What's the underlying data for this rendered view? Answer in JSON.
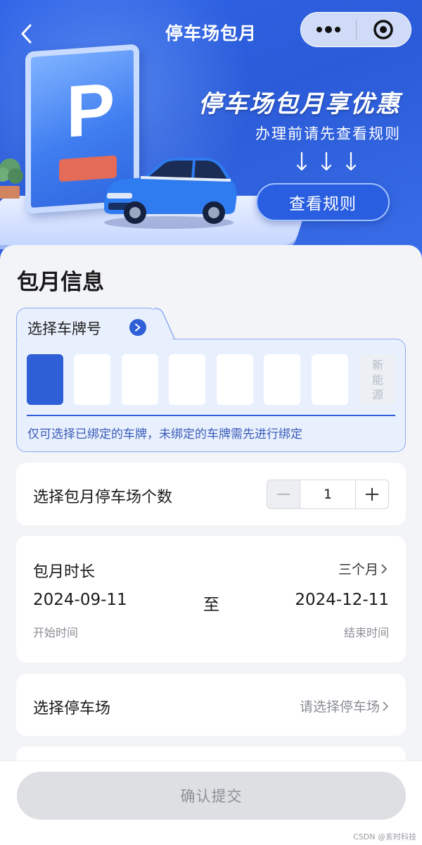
{
  "nav": {
    "title": "停车场包月",
    "back_icon": "chevron-left-icon",
    "more_icon": "more-dots-icon",
    "close_icon": "target-close-icon"
  },
  "banner": {
    "headline": "停车场包月享优惠",
    "subline": "办理前请先查看规则",
    "rules_button": "查看规则",
    "sign_letter": "P"
  },
  "info": {
    "section_title": "包月信息",
    "plate": {
      "label": "选择车牌号",
      "new_energy": [
        "新",
        "能",
        "源"
      ],
      "hint": "仅可选择已绑定的车牌，未绑定的车牌需先进行绑定"
    },
    "count": {
      "label": "选择包月停车场个数",
      "value": "1"
    },
    "duration": {
      "label": "包月时长",
      "value": "三个月",
      "start_date": "2024-09-11",
      "to": "至",
      "end_date": "2024-12-11",
      "start_label": "开始时间",
      "end_label": "结束时间"
    },
    "lot": {
      "label": "选择停车场",
      "placeholder": "请选择停车场"
    }
  },
  "footer": {
    "submit": "确认提交",
    "watermark": "CSDN @亥时科技"
  },
  "colors": {
    "primary": "#2f5fd6",
    "banner": "#2b5bd8",
    "plate_bg": "#e9f0fd",
    "disabled_button": "#dedfe2"
  }
}
